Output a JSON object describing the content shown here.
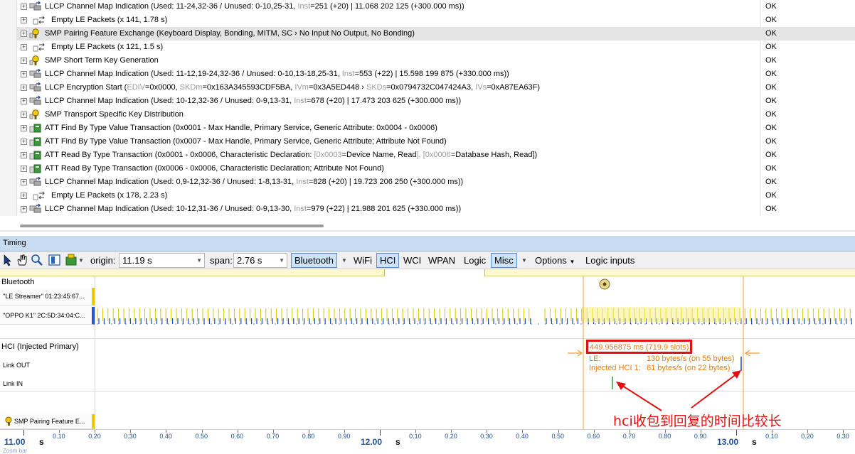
{
  "packets": [
    {
      "icon": "llcp",
      "parts": [
        [
          "LLCP Channel Map Indication (Used: 11-24,32-36 / Unused: 0-10,25-31, ",
          ""
        ],
        [
          "Inst",
          "gray"
        ],
        [
          "=251 (+20) | 11.068 202 125 (+300.000 ms))",
          ""
        ]
      ],
      "status": "OK"
    },
    {
      "icon": "empty",
      "parts": [
        [
          "Empty LE Packets (x 141, 1.78 s)",
          ""
        ]
      ],
      "status": "OK"
    },
    {
      "icon": "smp",
      "parts": [
        [
          "SMP Pairing Feature Exchange (Keyboard Display, Bonding, MITM, SC › No Input No Output, No Bonding)",
          ""
        ]
      ],
      "status": "OK",
      "selected": true
    },
    {
      "icon": "empty",
      "parts": [
        [
          "Empty LE Packets (x 121, 1.5 s)",
          ""
        ]
      ],
      "status": "OK"
    },
    {
      "icon": "smp",
      "parts": [
        [
          "SMP Short Term Key Generation",
          ""
        ]
      ],
      "status": "OK"
    },
    {
      "icon": "llcp",
      "parts": [
        [
          "LLCP Channel Map Indication (Used: 11-12,19-24,32-36 / Unused: 0-10,13-18,25-31, ",
          ""
        ],
        [
          "Inst",
          "gray"
        ],
        [
          "=553 (+22) | 15.598 199 875 (+330.000 ms))",
          ""
        ]
      ],
      "status": "OK"
    },
    {
      "icon": "llcp",
      "parts": [
        [
          "LLCP Encryption Start (",
          ""
        ],
        [
          "EDIV",
          "gray"
        ],
        [
          "=0x0000, ",
          ""
        ],
        [
          "SKDm",
          "gray"
        ],
        [
          "=0x163A345593CDF5BA, ",
          ""
        ],
        [
          "IVm",
          "gray"
        ],
        [
          "=0x3A5ED448 › ",
          ""
        ],
        [
          "SKDs",
          "gray"
        ],
        [
          "=0x0794732C047424A3, ",
          ""
        ],
        [
          "IVs",
          "gray"
        ],
        [
          "=0xA87EA63F)",
          ""
        ]
      ],
      "status": "OK"
    },
    {
      "icon": "llcp",
      "parts": [
        [
          "LLCP Channel Map Indication (Used: 10-12,32-36 / Unused: 0-9,13-31, ",
          ""
        ],
        [
          "Inst",
          "gray"
        ],
        [
          "=678 (+20) | 17.473 203 625 (+300.000 ms))",
          ""
        ]
      ],
      "status": "OK"
    },
    {
      "icon": "smp",
      "parts": [
        [
          "SMP Transport Specific Key Distribution",
          ""
        ]
      ],
      "status": "OK"
    },
    {
      "icon": "att",
      "parts": [
        [
          "ATT Find By Type Value Transaction (0x0001 - Max Handle, Primary Service, Generic Attribute: 0x0004 - 0x0006)",
          ""
        ]
      ],
      "status": "OK"
    },
    {
      "icon": "att",
      "parts": [
        [
          "ATT Find By Type Value Transaction (0x0007 - Max Handle, Primary Service, Generic Attribute; Attribute Not Found)",
          ""
        ]
      ],
      "status": "OK"
    },
    {
      "icon": "att",
      "parts": [
        [
          "ATT Read By Type Transaction (0x0001 - 0x0006, Characteristic Declaration: ",
          ""
        ],
        [
          "[0x0003",
          "gray"
        ],
        [
          "=Device Name, Read",
          ""
        ],
        [
          "], [0x0006",
          "gray"
        ],
        [
          "=Database Hash, Read",
          ""
        ],
        [
          "])",
          ""
        ]
      ],
      "status": "OK"
    },
    {
      "icon": "att",
      "parts": [
        [
          "ATT Read By Type Transaction (0x0006 - 0x0006, Characteristic Declaration; Attribute Not Found)",
          ""
        ]
      ],
      "status": "OK"
    },
    {
      "icon": "llcp",
      "parts": [
        [
          "LLCP Channel Map Indication (Used: 0,9-12,32-36 / Unused: 1-8,13-31, ",
          ""
        ],
        [
          "Inst",
          "gray"
        ],
        [
          "=828 (+20) | 19.723 206 250 (+300.000 ms))",
          ""
        ]
      ],
      "status": "OK"
    },
    {
      "icon": "empty",
      "parts": [
        [
          "Empty LE Packets (x 178, 2.23 s)",
          ""
        ]
      ],
      "status": "OK"
    },
    {
      "icon": "llcp",
      "parts": [
        [
          "LLCP Channel Map Indication (Used: 10-12,31-36 / Unused: 0-9,13-30, ",
          ""
        ],
        [
          "Inst",
          "gray"
        ],
        [
          "=979 (+22) | 21.988 201 625 (+330.000 ms))",
          ""
        ]
      ],
      "status": "OK"
    }
  ],
  "timing": {
    "title": "Timing",
    "toolbar": {
      "origin_label": "origin:",
      "origin_value": "11.19 s",
      "span_label": "span:",
      "span_value": "2.76 s",
      "buttons": [
        {
          "label": "Bluetooth",
          "active": true
        },
        {
          "label": "WiFi",
          "active": false
        },
        {
          "label": "HCI",
          "active": true
        },
        {
          "label": "WCI",
          "active": false
        },
        {
          "label": "WPAN",
          "active": false
        },
        {
          "label": "Logic",
          "active": false
        },
        {
          "label": "Misc",
          "active": true
        }
      ],
      "options_label": "Options",
      "logic_inputs_label": "Logic inputs"
    },
    "lanes": {
      "bluetooth": "Bluetooth",
      "device1": "\"LE Streamer\" 01:23:45:67...",
      "device2": "\"OPPO K1\" 2C:5D:34:04:C...",
      "hci": "HCI (Injected Primary)",
      "link_out": "Link OUT",
      "link_in": "Link IN",
      "marker": "SMP Pairing Feature E..."
    },
    "measurement": {
      "duration": "449.956875 ms  (719.9 slots)",
      "le_label": "LE:",
      "le_value": "130 bytes/s (on 55 bytes)",
      "hci_label": "Injected HCI 1:",
      "hci_value": "61 bytes/s (on 22 bytes)"
    },
    "annotation": "hci收包到回复的时间比较长",
    "axis": {
      "major": [
        "11.00",
        "12.00",
        "13.00"
      ],
      "major_unit": "s",
      "minor": [
        "0.10",
        "0.20",
        "0.30",
        "0.40",
        "0.50",
        "0.60",
        "0.70",
        "0.80",
        "0.90"
      ]
    },
    "zoom_label": "Zoom bar"
  },
  "colors": {
    "selection": "#e4e4e4",
    "header_bg": "#c8dcf0",
    "active_btn": "#cde3f8",
    "cursor_line": "#f0a030",
    "annotation_red": "#e01010",
    "device1_bar": "#f2c800",
    "device2_bar": "#2357c7"
  }
}
